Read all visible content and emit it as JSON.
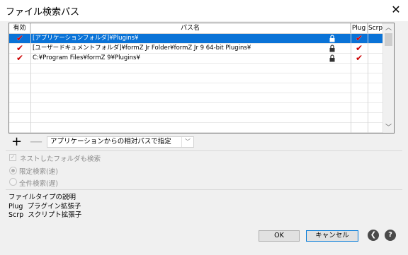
{
  "window": {
    "title": "ファイル検索パス",
    "close_label": "✕"
  },
  "table": {
    "headers": {
      "enabled": "有効",
      "path": "パス名",
      "plug": "Plug",
      "scrp": "Scrp"
    },
    "rows": [
      {
        "enabled": true,
        "path": "[アプリケーションフォルダ]¥Plugins¥",
        "locked": true,
        "plug": true,
        "scrp": false,
        "selected": true
      },
      {
        "enabled": true,
        "path": "[ユーザードキュメントフォルダ]¥formZ Jr Folder¥formZ Jr 9 64-bit Plugins¥",
        "locked": true,
        "plug": true,
        "scrp": false,
        "selected": false
      },
      {
        "enabled": true,
        "path": "C:¥Program Files¥formZ 9¥Plugins¥",
        "locked": true,
        "plug": true,
        "scrp": false,
        "selected": false
      }
    ]
  },
  "toolbar": {
    "add_label": "+",
    "remove_label": "—",
    "mode_value": "アプリケーションからの相対パスで指定"
  },
  "options": {
    "nested_label": "ネストしたフォルダも検索",
    "radio_fast_label": "限定検索(速)",
    "radio_full_label": "全件検索(遅)"
  },
  "description": {
    "title": "ファイルタイプの説明",
    "plug_line": "Plug  プラグイン拡張子",
    "scrp_line": "Scrp  スクリプト拡張子"
  },
  "buttons": {
    "ok_label": "OK",
    "cancel_label": "キャンセル",
    "back_icon_glyph": "❮",
    "help_icon_glyph": "?"
  },
  "colors": {
    "selection": "#0a73d7",
    "check": "#cc0000",
    "default_button_border": "#0078d7"
  }
}
